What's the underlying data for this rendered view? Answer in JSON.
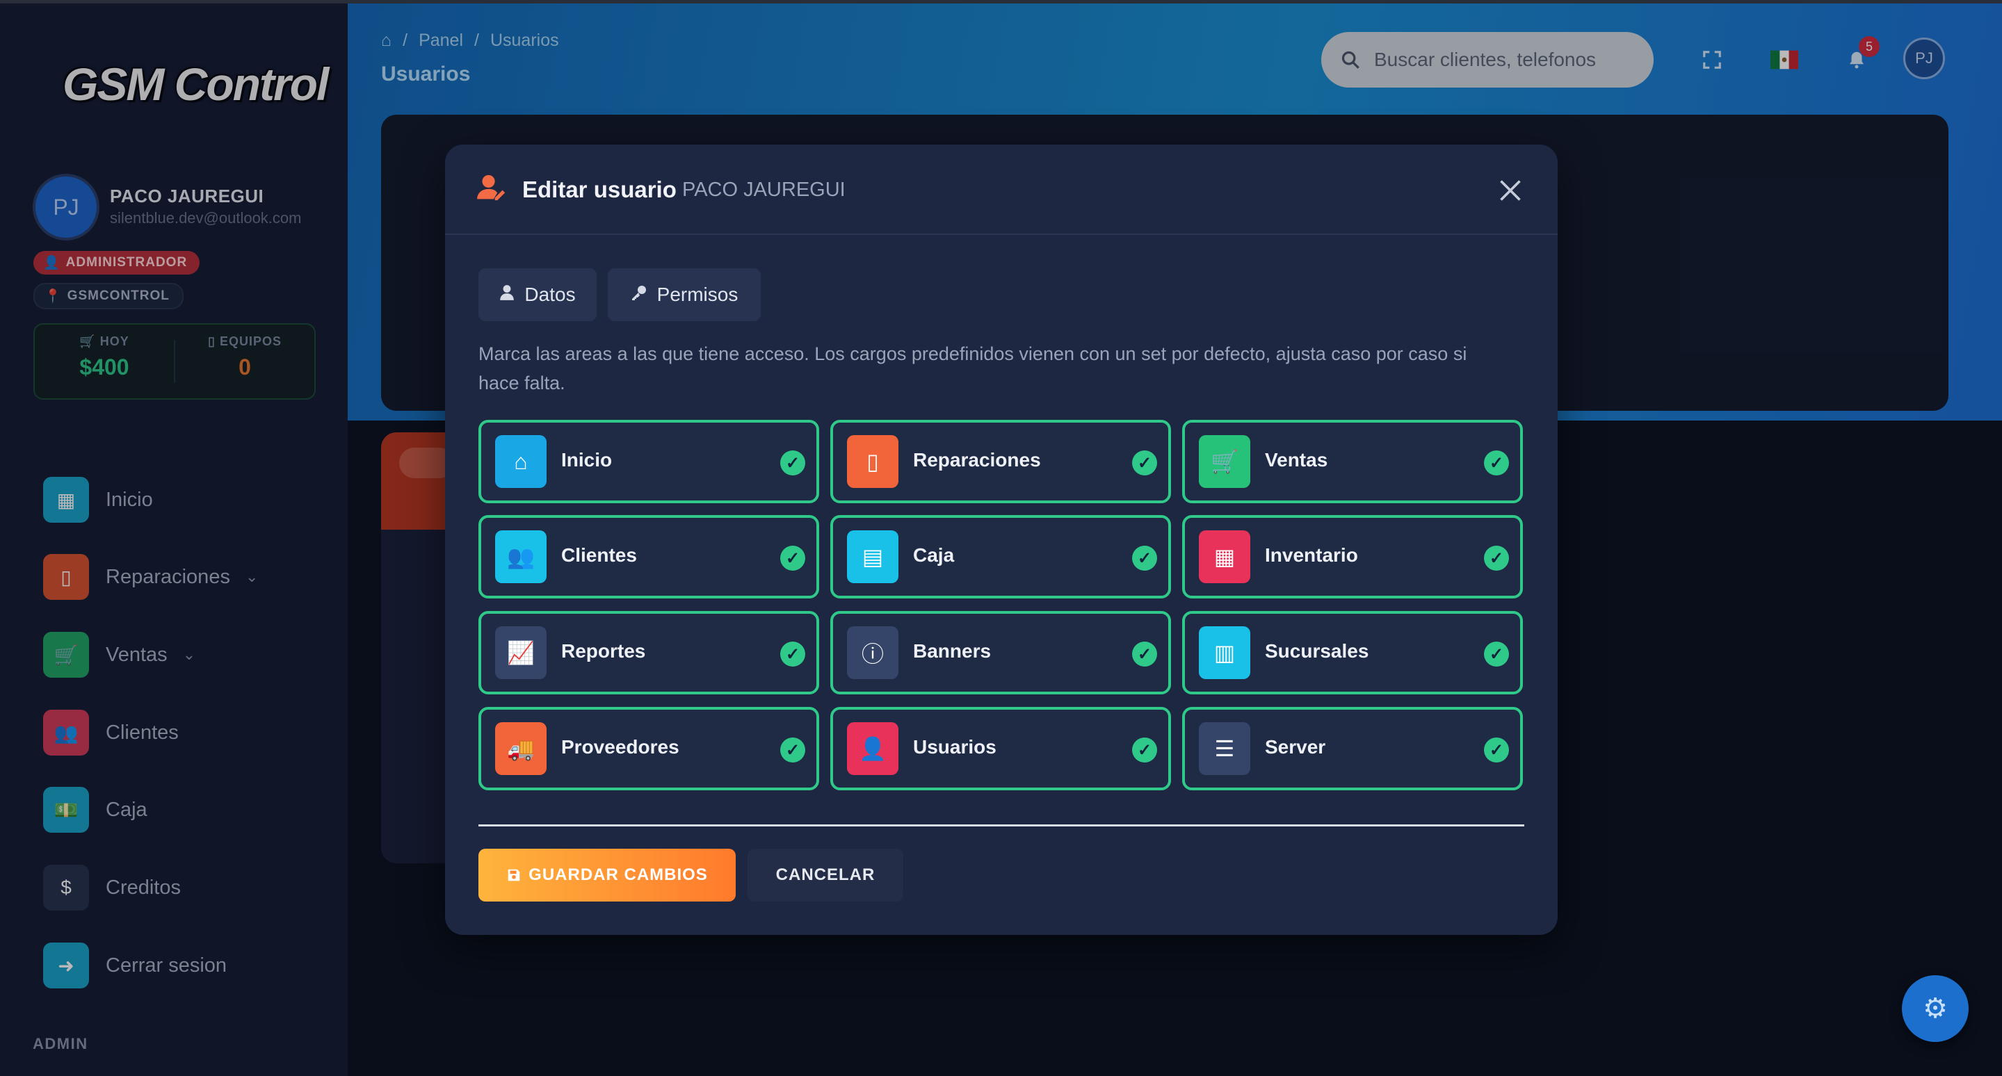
{
  "sidebar": {
    "logo": "GSM Control",
    "avatar_initials": "PJ",
    "user_name": "PACO JAUREGUI",
    "user_email": "silentblue.dev@outlook.com",
    "role_badge": "ADMINISTRADOR",
    "branch_badge": "GSMCONTROL",
    "stats": [
      {
        "label": "HOY",
        "value": "$400",
        "icon": "cart-icon",
        "color": "#2fc98a"
      },
      {
        "label": "EQUIPOS",
        "value": "0",
        "icon": "phone-icon",
        "color": "#e8742d"
      }
    ],
    "nav": [
      {
        "label": "Inicio",
        "icon": "dashboard-icon",
        "color": "#1aa2c7",
        "chevron": false
      },
      {
        "label": "Reparaciones",
        "icon": "phone-icon",
        "color": "#d9532e",
        "chevron": true
      },
      {
        "label": "Ventas",
        "icon": "cart-icon",
        "color": "#22a564",
        "chevron": true
      },
      {
        "label": "Clientes",
        "icon": "users-icon",
        "color": "#d23b58",
        "chevron": false
      },
      {
        "label": "Caja",
        "icon": "cash-icon",
        "color": "#1aa2c7",
        "chevron": false
      },
      {
        "label": "Creditos",
        "icon": "credit-hand-icon",
        "color": "#28324d",
        "chevron": false
      },
      {
        "label": "Cerrar sesion",
        "icon": "logout-icon",
        "color": "#1aa2c7",
        "chevron": false
      }
    ],
    "section_label": "ADMIN"
  },
  "header": {
    "breadcrumb": [
      "Panel",
      "Usuarios"
    ],
    "title": "Usuarios",
    "search_placeholder": "Buscar clientes, telefonos",
    "notification_count": "5",
    "avatar_initials": "PJ"
  },
  "modal": {
    "title": "Editar usuario",
    "subtitle": "PACO JAUREGUI",
    "tabs": [
      {
        "label": "Datos",
        "icon": "user-icon"
      },
      {
        "label": "Permisos",
        "icon": "key-icon"
      }
    ],
    "description": "Marca las areas a las que tiene acceso. Los cargos predefinidos vienen con un set por defecto, ajusta caso por caso si hace falta.",
    "permissions": [
      {
        "label": "Inicio",
        "icon": "home-icon",
        "color": "#1aa7e6",
        "checked": true
      },
      {
        "label": "Reparaciones",
        "icon": "phone-icon",
        "color": "#f2643a",
        "checked": true
      },
      {
        "label": "Ventas",
        "icon": "cart-icon",
        "color": "#27c27a",
        "checked": true
      },
      {
        "label": "Clientes",
        "icon": "users-icon",
        "color": "#19c1e8",
        "checked": true
      },
      {
        "label": "Caja",
        "icon": "cash-register-icon",
        "color": "#19c1e8",
        "checked": true
      },
      {
        "label": "Inventario",
        "icon": "boxes-icon",
        "color": "#e8325a",
        "checked": true
      },
      {
        "label": "Reportes",
        "icon": "chart-icon",
        "color": "#35456a",
        "checked": true
      },
      {
        "label": "Banners",
        "icon": "info-icon",
        "color": "#35456a",
        "checked": true
      },
      {
        "label": "Sucursales",
        "icon": "building-icon",
        "color": "#19c1e8",
        "checked": true
      },
      {
        "label": "Proveedores",
        "icon": "truck-icon",
        "color": "#f2643a",
        "checked": true
      },
      {
        "label": "Usuarios",
        "icon": "user-shield-icon",
        "color": "#e8325a",
        "checked": true
      },
      {
        "label": "Server",
        "icon": "server-icon",
        "color": "#35456a",
        "checked": true
      }
    ],
    "save_label": "GUARDAR CAMBIOS",
    "cancel_label": "CANCELAR"
  }
}
